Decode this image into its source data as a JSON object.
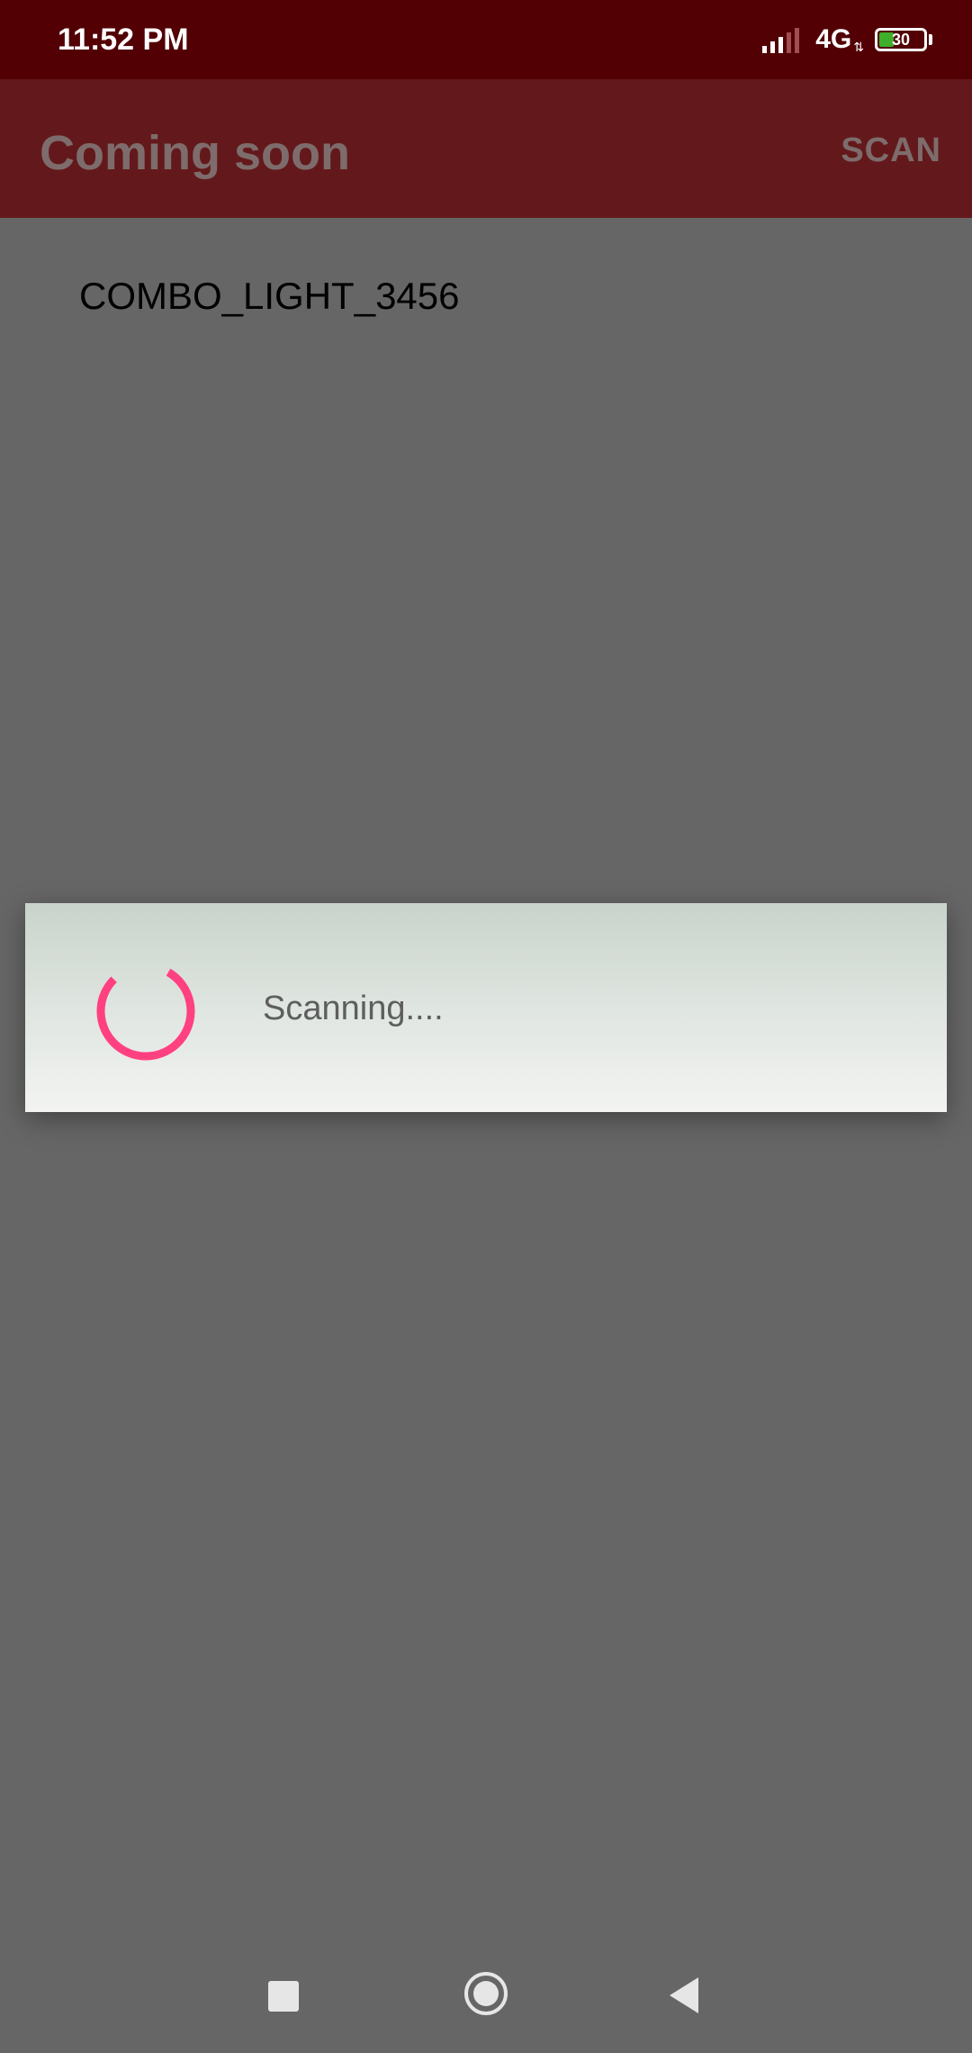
{
  "status_bar": {
    "time": "11:52 PM",
    "network": "4G",
    "battery_level": "30",
    "icons": [
      "signal-icon",
      "network-activity-icon",
      "battery-icon"
    ]
  },
  "app_bar": {
    "title": "Coming soon",
    "scan_label": "SCAN"
  },
  "devices": [
    {
      "name": "COMBO_LIGHT_3456"
    }
  ],
  "dialog": {
    "message": "Scanning....",
    "spinner_color": "#ff4081"
  },
  "nav_bar": {
    "icons": [
      "recents-square-icon",
      "home-circle-icon",
      "back-triangle-icon"
    ]
  },
  "colors": {
    "status_bar": "#520004",
    "app_bar": "#63191b",
    "scrim_background": "#666666"
  }
}
